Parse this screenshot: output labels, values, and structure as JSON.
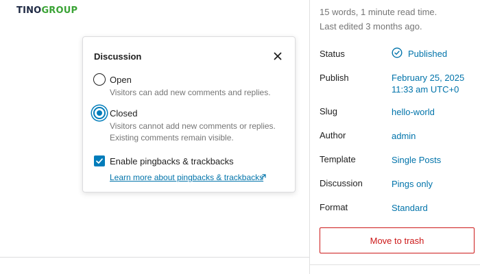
{
  "logo": {
    "part1": "TINO",
    "part2": "GROUP"
  },
  "popover": {
    "title": "Discussion",
    "options": [
      {
        "label": "Open",
        "help": "Visitors can add new comments and replies.",
        "checked": false
      },
      {
        "label": "Closed",
        "help": "Visitors cannot add new comments or replies. Existing comments remain visible.",
        "checked": true
      }
    ],
    "pingbacks": {
      "label": "Enable pingbacks & trackbacks",
      "checked": true
    },
    "learn_more": "Learn more about pingbacks & trackbacks"
  },
  "sidebar": {
    "word_count": "15 words, 1 minute read time.",
    "last_edited": "Last edited 3 months ago.",
    "rows": [
      {
        "label": "Status",
        "value": "Published"
      },
      {
        "label": "Publish",
        "value": "February 25, 2025",
        "value2": "11:33 am UTC+0"
      },
      {
        "label": "Slug",
        "value": "hello-world"
      },
      {
        "label": "Author",
        "value": "admin"
      },
      {
        "label": "Template",
        "value": "Single Posts"
      },
      {
        "label": "Discussion",
        "value": "Pings only"
      },
      {
        "label": "Format",
        "value": "Standard"
      }
    ],
    "trash_label": "Move to trash"
  },
  "colors": {
    "accent": "#007cba",
    "link": "#0073aa",
    "danger": "#cc1818",
    "brand_green": "#3aa335"
  }
}
